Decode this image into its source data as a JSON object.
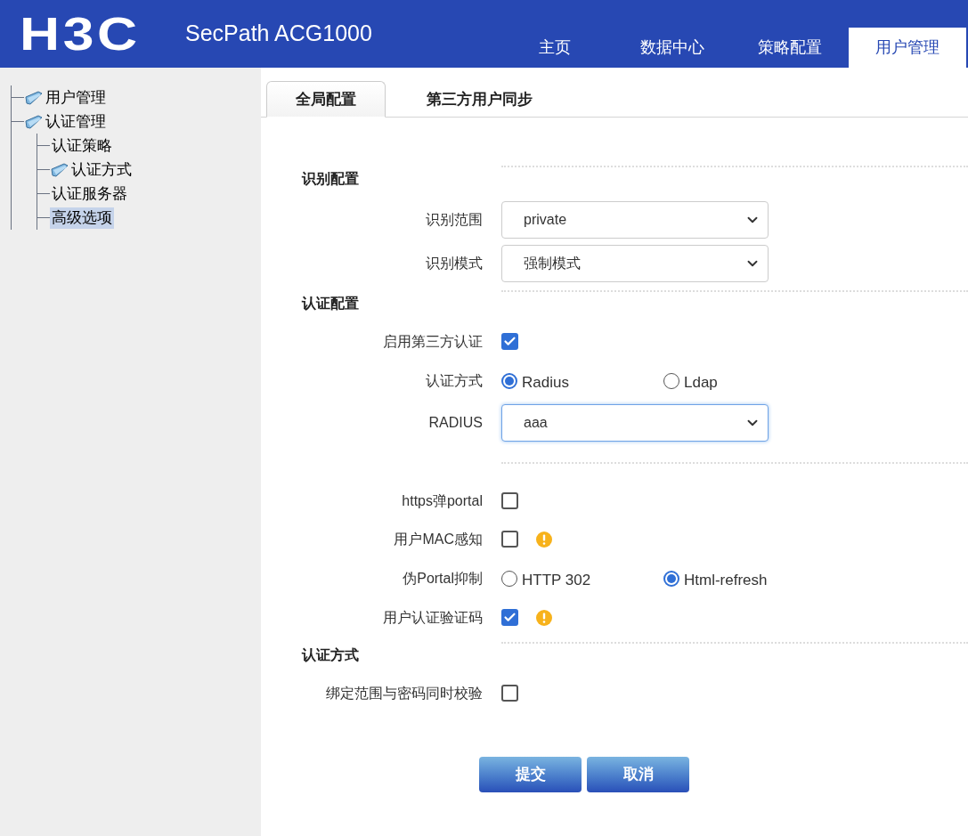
{
  "header": {
    "logo": "H3C",
    "product": "SecPath ACG1000",
    "nav": [
      {
        "label": "主页",
        "selected": false
      },
      {
        "label": "数据中心",
        "selected": false
      },
      {
        "label": "策略配置",
        "selected": false
      },
      {
        "label": "用户管理",
        "selected": true
      }
    ]
  },
  "sidebar": {
    "tree": [
      {
        "label": "用户管理",
        "folder": true,
        "selected": false
      },
      {
        "label": "认证管理",
        "folder": true,
        "selected": false,
        "children": [
          {
            "label": "认证策略",
            "folder": false,
            "selected": false
          },
          {
            "label": "认证方式",
            "folder": true,
            "selected": false
          },
          {
            "label": "认证服务器",
            "folder": false,
            "selected": false
          },
          {
            "label": "高级选项",
            "folder": false,
            "selected": true
          }
        ]
      }
    ]
  },
  "tabs": [
    {
      "label": "全局配置",
      "selected": true
    },
    {
      "label": "第三方用户同步",
      "selected": false
    }
  ],
  "form": [
    {
      "kind": "section",
      "title": "识别配置"
    },
    {
      "kind": "select",
      "label": "识别范围",
      "value": "private",
      "focused": false
    },
    {
      "kind": "select",
      "label": "识别模式",
      "value": "强制模式",
      "focused": false
    },
    {
      "kind": "section",
      "title": "认证配置"
    },
    {
      "kind": "checkbox",
      "label": "启用第三方认证",
      "checked": true,
      "warning": false
    },
    {
      "kind": "radio",
      "label": "认证方式",
      "options": [
        {
          "label": "Radius",
          "selected": true
        },
        {
          "label": "Ldap",
          "selected": false
        }
      ]
    },
    {
      "kind": "select",
      "label": "RADIUS",
      "value": "aaa",
      "focused": true
    },
    {
      "kind": "divider"
    },
    {
      "kind": "checkbox",
      "label": "https弹portal",
      "checked": false,
      "warning": false
    },
    {
      "kind": "checkbox",
      "label": "用户MAC感知",
      "checked": false,
      "warning": true
    },
    {
      "kind": "radio",
      "label": "伪Portal抑制",
      "options": [
        {
          "label": "HTTP 302",
          "selected": false
        },
        {
          "label": "Html-refresh",
          "selected": true
        }
      ]
    },
    {
      "kind": "checkbox",
      "label": "用户认证验证码",
      "checked": true,
      "warning": true
    },
    {
      "kind": "section",
      "title": "认证方式"
    },
    {
      "kind": "checkbox",
      "label": "绑定范围与密码同时校验",
      "checked": false,
      "warning": false
    }
  ],
  "buttons": [
    "提交",
    "取消"
  ]
}
